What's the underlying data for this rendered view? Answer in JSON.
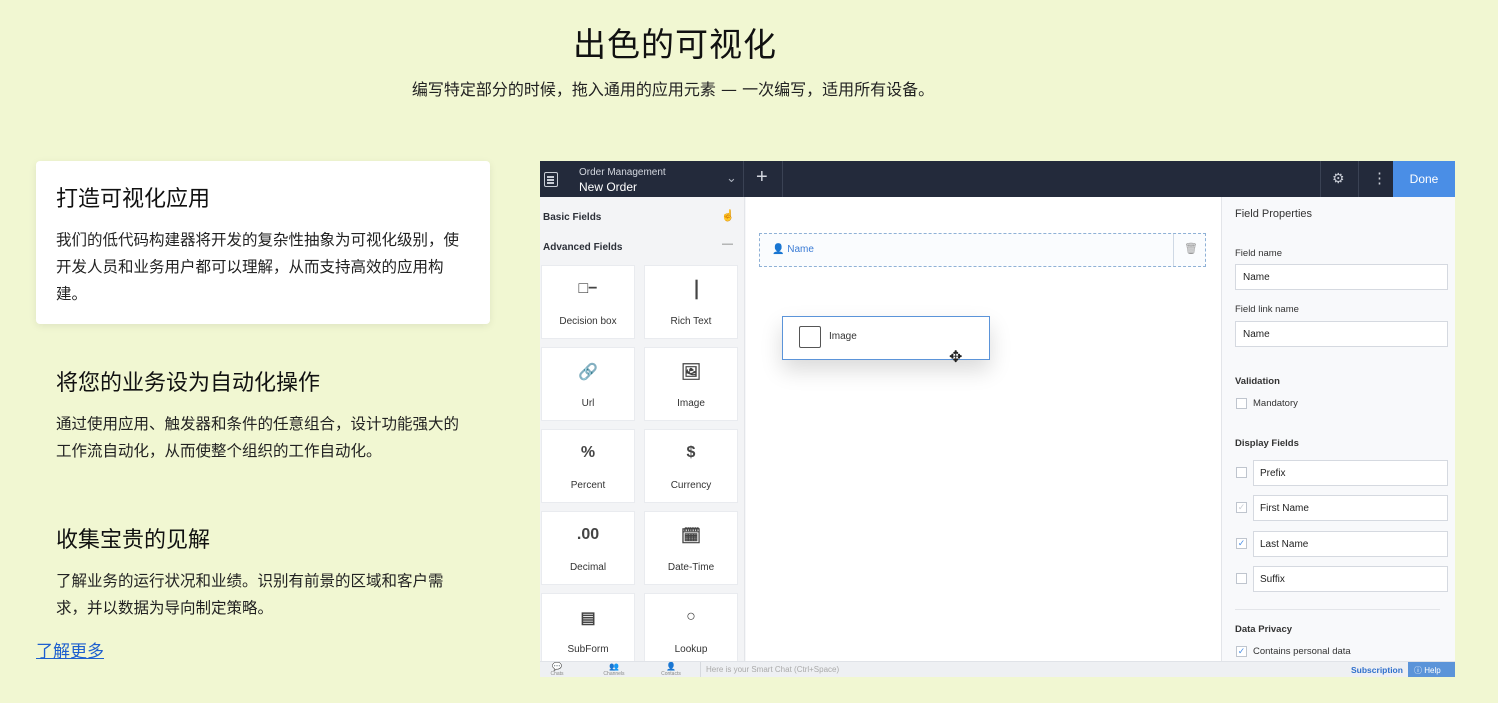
{
  "hero": {
    "title": "出色的可视化",
    "subtitle": "编写特定部分的时候，拖入通用的应用元素 — 一次编写，适用所有设备。"
  },
  "features": [
    {
      "title": "打造可视化应用",
      "text": "我们的低代码构建器将开发的复杂性抽象为可视化级别，使开发人员和业务用户都可以理解，从而支持高效的应用构建。"
    },
    {
      "title": "将您的业务设为自动化操作",
      "text": "通过使用应用、触发器和条件的任意组合，设计功能强大的工作流自动化，从而使整个组织的工作自动化。"
    },
    {
      "title": "收集宝贵的见解",
      "text": "了解业务的运行状况和业绩。识别有前景的区域和客户需求，并以数据为导向制定策略。"
    }
  ],
  "learn_more": "了解更多",
  "app": {
    "topbar": {
      "app_name": "Order Management",
      "form_name": "New Order",
      "done": "Done"
    },
    "palette": {
      "basic_fields": "Basic Fields",
      "advanced_fields": "Advanced Fields",
      "tiles": [
        {
          "icon": "□−",
          "label": "Decision box"
        },
        {
          "icon": "▕",
          "label": "Rich Text"
        },
        {
          "icon": "🔗",
          "label": "Url"
        },
        {
          "icon": "🖼",
          "label": "Image"
        },
        {
          "icon": "%",
          "label": "Percent"
        },
        {
          "icon": "$",
          "label": "Currency"
        },
        {
          "icon": ".00",
          "label": "Decimal"
        },
        {
          "icon": "🗓",
          "label": "Date-Time"
        },
        {
          "icon": "▤",
          "label": "SubForm"
        },
        {
          "icon": "○",
          "label": "Lookup"
        }
      ]
    },
    "canvas": {
      "name_field": "Name",
      "drag_item": "Image"
    },
    "props": {
      "title": "Field Properties",
      "field_name_label": "Field name",
      "field_name_value": "Name",
      "field_link_label": "Field link name",
      "field_link_value": "Name",
      "validation": "Validation",
      "mandatory": "Mandatory",
      "display_fields": "Display Fields",
      "display": [
        {
          "label": "Prefix",
          "checked": false
        },
        {
          "label": "First Name",
          "checked": true
        },
        {
          "label": "Last Name",
          "checked": true
        },
        {
          "label": "Suffix",
          "checked": false
        }
      ],
      "data_privacy": "Data Privacy",
      "contains_personal": "Contains personal data"
    },
    "bottombar": {
      "chats": "Chats",
      "channels": "Channels",
      "contacts": "Contacts",
      "chat_placeholder": "Here is your Smart Chat (Ctrl+Space)",
      "subscription": "Subscription",
      "help": "Help"
    }
  }
}
